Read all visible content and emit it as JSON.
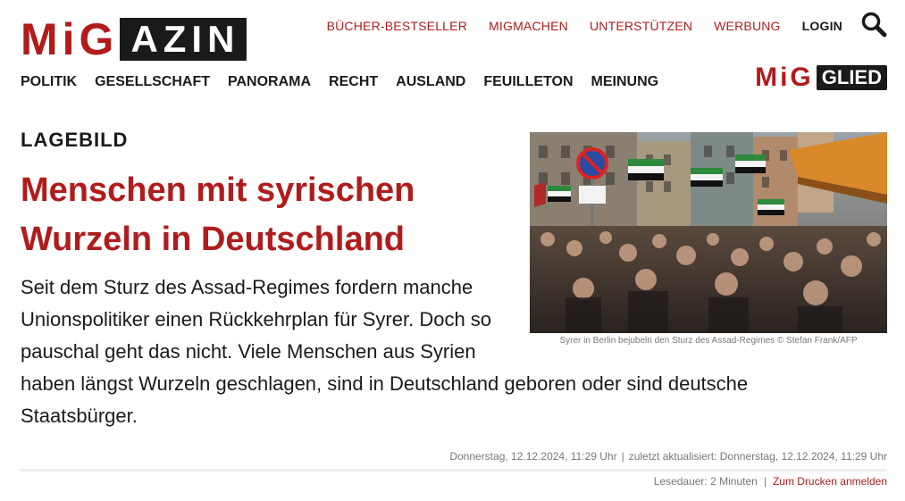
{
  "logo": {
    "part1": "MiG",
    "part2": "AZIN"
  },
  "topnav": {
    "items": [
      {
        "label": "BÜCHER-BESTSELLER"
      },
      {
        "label": "MIGMACHEN"
      },
      {
        "label": "UNTERSTÜTZEN"
      },
      {
        "label": "WERBUNG"
      }
    ],
    "login": "LOGIN"
  },
  "mainnav": {
    "items": [
      {
        "label": "POLITIK"
      },
      {
        "label": "GESELLSCHAFT"
      },
      {
        "label": "PANORAMA"
      },
      {
        "label": "RECHT"
      },
      {
        "label": "AUSLAND"
      },
      {
        "label": "FEUILLETON"
      },
      {
        "label": "MEINUNG"
      }
    ]
  },
  "member_logo": {
    "part1": "MiG",
    "part2": "GLIED"
  },
  "article": {
    "kicker": "LAGEBILD",
    "headline": "Menschen mit syrischen Wurzeln in Deutschland",
    "lead_1": "Seit dem Sturz des Assad-Regimes fordern manche Unionspolitiker einen Rückkehrplan für Syrer. Doch so pauschal geht das nicht. Viele Menschen aus Syrien",
    "lead_2": "haben längst Wurzeln geschlagen, sind in Deutschland geboren oder sind deutsche Staatsbürger.",
    "image_caption": "Syrer in Berlin bejubeln den Sturz des Assad-Regimes © Stefan Frank/AFP",
    "published": "Donnerstag, 12.12.2024, 11:29 Uhr",
    "updated": "zuletzt aktualisiert: Donnerstag, 12.12.2024, 11:29 Uhr",
    "reading_time": "Lesedauer: 2 Minuten",
    "print_link": "Zum Drucken anmelden",
    "separator": "|"
  },
  "colors": {
    "accent": "#b01c1c",
    "dark": "#1a1a1a",
    "muted": "#777777"
  },
  "icons": {
    "search": "search-icon"
  }
}
